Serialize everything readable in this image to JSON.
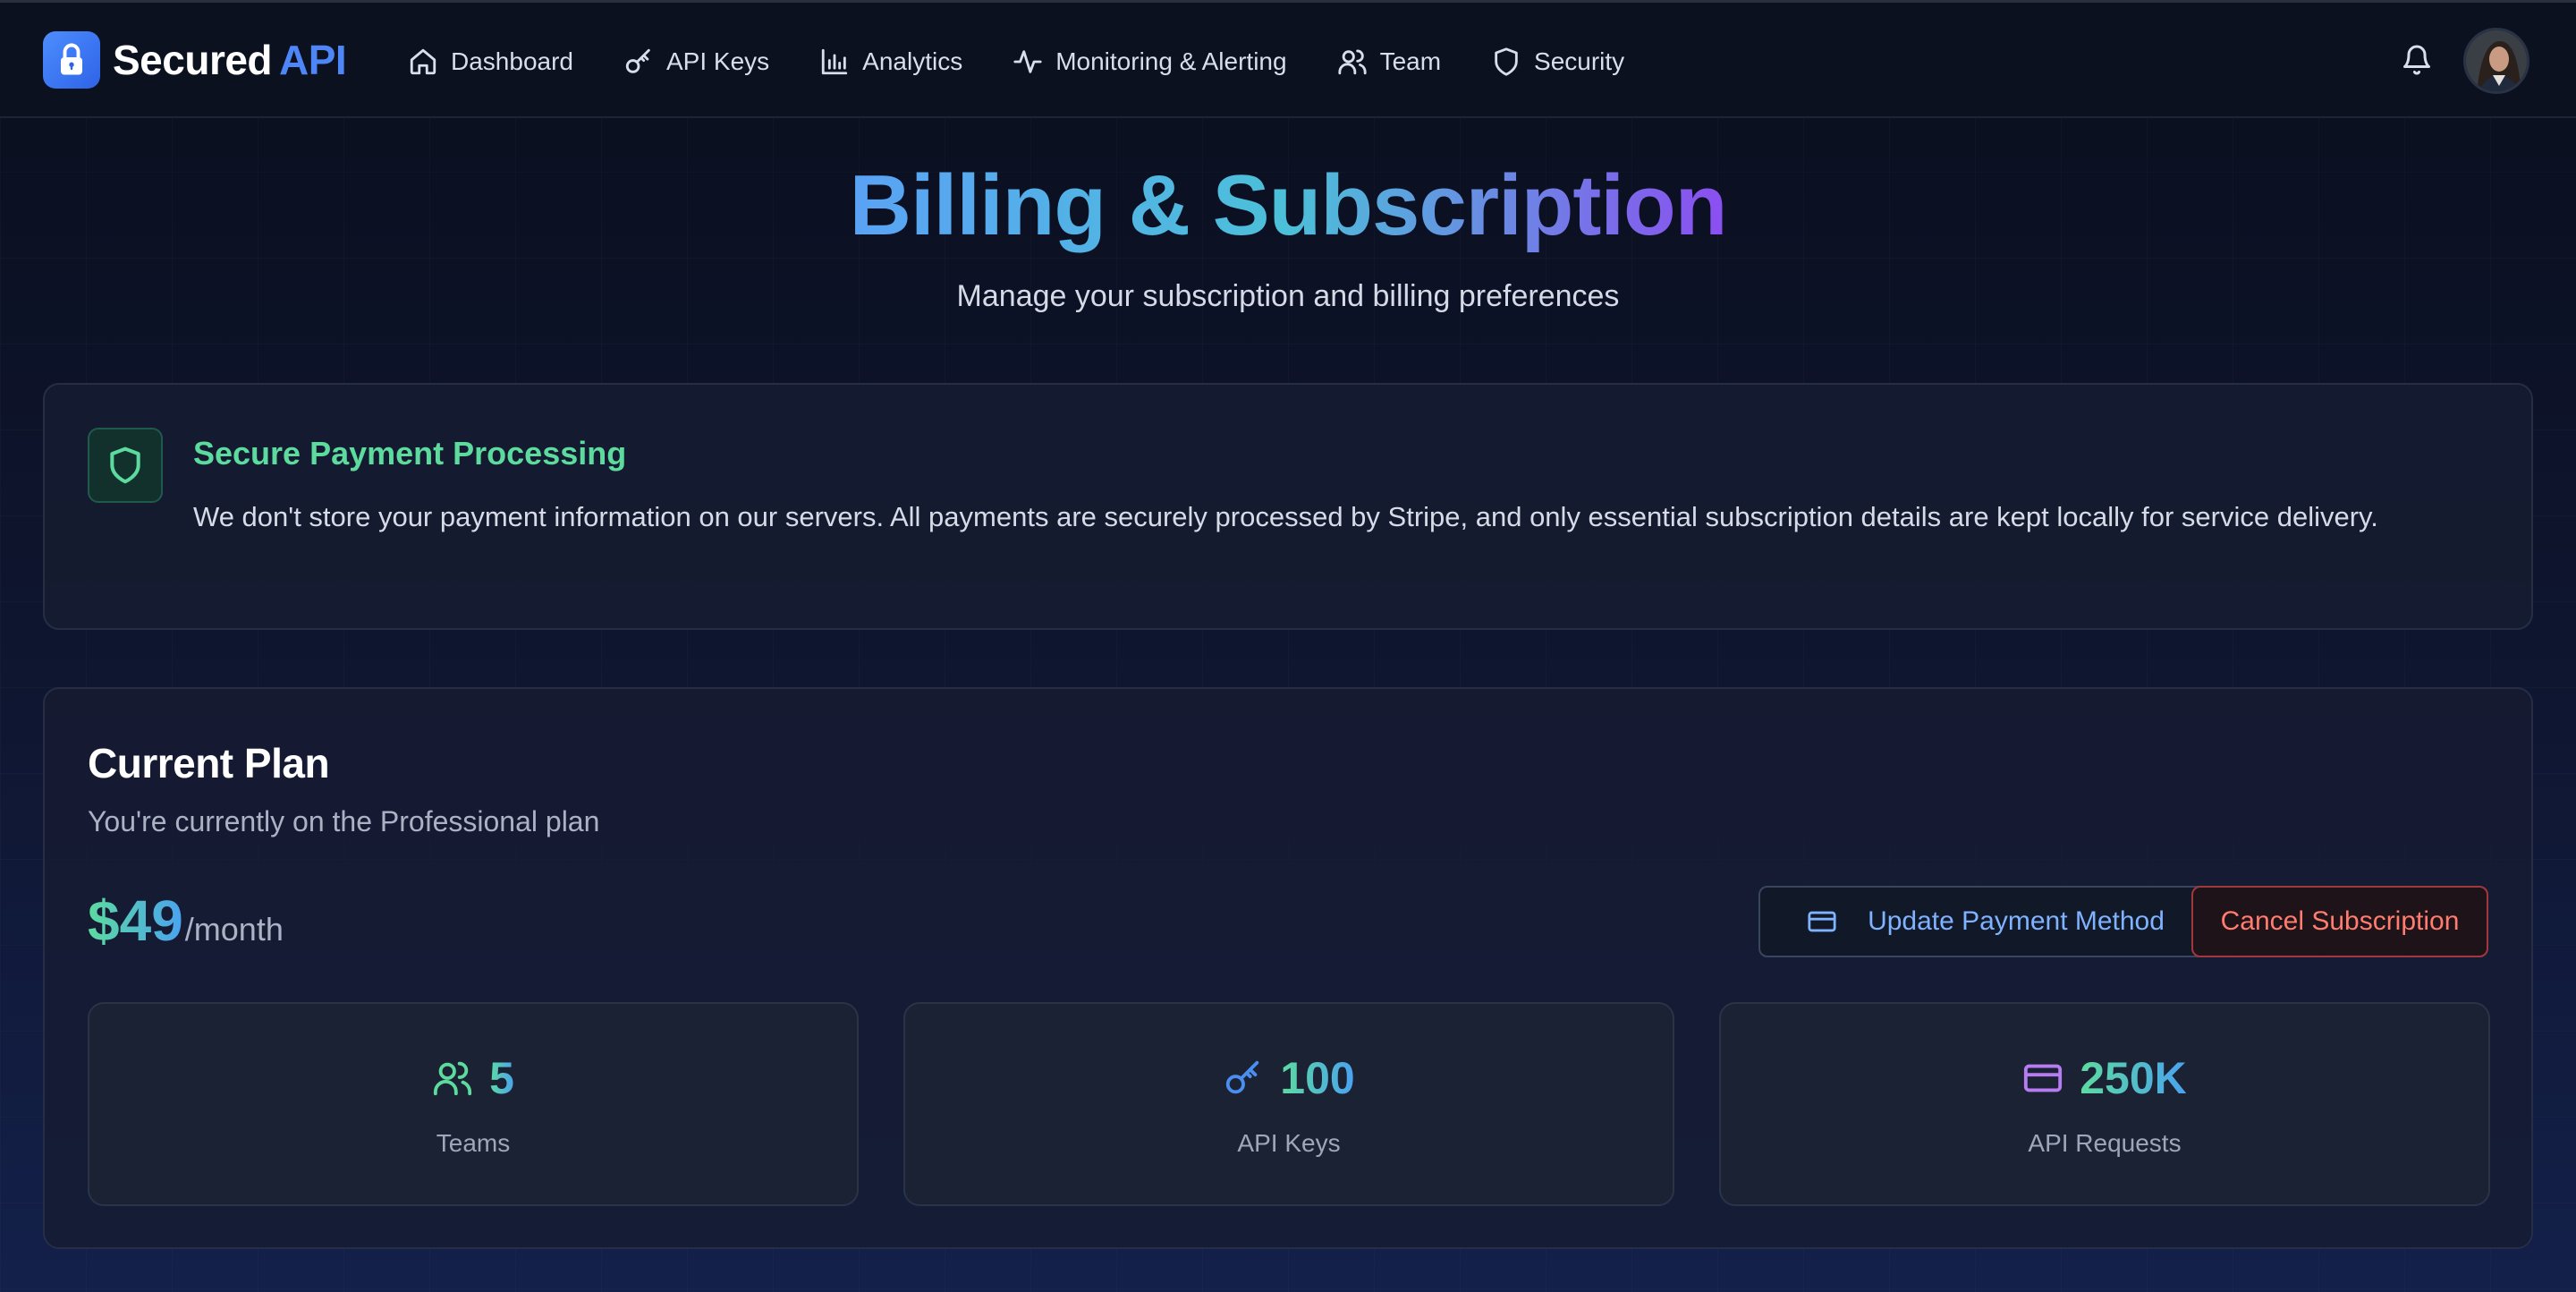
{
  "brand": {
    "name": "Secured",
    "accent": "API"
  },
  "nav": {
    "items": [
      {
        "label": "Dashboard",
        "icon": "home-icon"
      },
      {
        "label": "API Keys",
        "icon": "key-icon"
      },
      {
        "label": "Analytics",
        "icon": "bar-chart-icon"
      },
      {
        "label": "Monitoring & Alerting",
        "icon": "activity-icon"
      },
      {
        "label": "Team",
        "icon": "users-icon"
      },
      {
        "label": "Security",
        "icon": "shield-icon"
      }
    ]
  },
  "hero": {
    "title": "Billing & Subscription",
    "subtitle": "Manage your subscription and billing preferences"
  },
  "secure_banner": {
    "title": "Secure Payment Processing",
    "text": "We don't store your payment information on our servers. All payments are securely processed by Stripe, and only essential subscription details are kept locally for service delivery."
  },
  "plan": {
    "title": "Current Plan",
    "subtitle": "You're currently on the Professional plan",
    "price": "$49",
    "price_unit": "/month",
    "update_button": "Update Payment Method",
    "cancel_button": "Cancel Subscription",
    "stats": [
      {
        "value": "5",
        "label": "Teams",
        "icon": "users-icon"
      },
      {
        "value": "100",
        "label": "API Keys",
        "icon": "key-icon"
      },
      {
        "value": "250K",
        "label": "API Requests",
        "icon": "credit-card-icon"
      }
    ]
  },
  "colors": {
    "accent_blue": "#4f86f7",
    "success_green": "#5ddb9f",
    "danger_red": "#ff7c6e",
    "purple": "#b77cf2"
  }
}
